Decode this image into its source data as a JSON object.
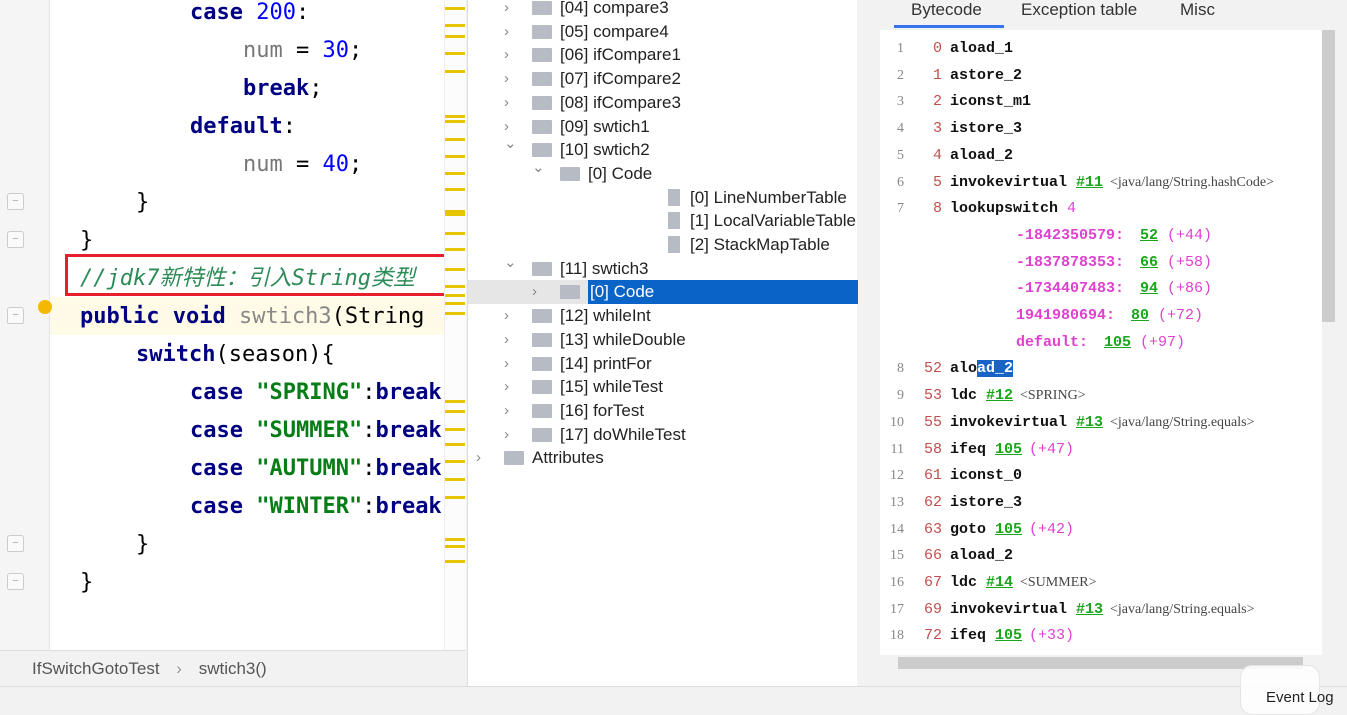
{
  "editor": {
    "lines": [
      {
        "indent": 3,
        "tokens": [
          [
            "case ",
            "kw"
          ],
          [
            "200",
            "num"
          ],
          [
            ":",
            "pl"
          ]
        ]
      },
      {
        "indent": 4,
        "tokens": [
          [
            "num",
            "var"
          ],
          [
            " = ",
            "pl"
          ],
          [
            "30",
            "num"
          ],
          [
            ";",
            "pl"
          ]
        ]
      },
      {
        "indent": 4,
        "tokens": [
          [
            "break",
            "kw"
          ],
          [
            ";",
            "pl"
          ]
        ]
      },
      {
        "indent": 3,
        "tokens": [
          [
            "default",
            "kw"
          ],
          [
            ":",
            "pl"
          ]
        ]
      },
      {
        "indent": 4,
        "tokens": [
          [
            "num",
            "var"
          ],
          [
            " = ",
            "pl"
          ],
          [
            "40",
            "num"
          ],
          [
            ";",
            "pl"
          ]
        ]
      },
      {
        "indent": 2,
        "tokens": [
          [
            "}",
            "pl"
          ]
        ]
      },
      {
        "indent": 1,
        "tokens": [
          [
            "}",
            "pl"
          ]
        ]
      },
      {
        "indent": 1,
        "tokens": [
          [
            "//jdk7新特性：引入String类型",
            "cm"
          ]
        ]
      },
      {
        "indent": 1,
        "tokens": [
          [
            "public void ",
            "kw"
          ],
          [
            "swtich3",
            "mt"
          ],
          [
            "(String ",
            "pl"
          ]
        ]
      },
      {
        "indent": 2,
        "tokens": [
          [
            "switch",
            "kw"
          ],
          [
            "(season){",
            "pl"
          ]
        ]
      },
      {
        "indent": 3,
        "tokens": [
          [
            "case ",
            "kw"
          ],
          [
            "\"SPRING\"",
            "str"
          ],
          [
            ":",
            "pl"
          ],
          [
            "break",
            "kw"
          ],
          [
            ";",
            "pl"
          ]
        ]
      },
      {
        "indent": 3,
        "tokens": [
          [
            "case ",
            "kw"
          ],
          [
            "\"SUMMER\"",
            "str"
          ],
          [
            ":",
            "pl"
          ],
          [
            "break",
            "kw"
          ],
          [
            ";",
            "pl"
          ]
        ]
      },
      {
        "indent": 3,
        "tokens": [
          [
            "case ",
            "kw"
          ],
          [
            "\"AUTUMN\"",
            "str"
          ],
          [
            ":",
            "pl"
          ],
          [
            "break",
            "kw"
          ],
          [
            ";",
            "pl"
          ]
        ]
      },
      {
        "indent": 3,
        "tokens": [
          [
            "case ",
            "kw"
          ],
          [
            "\"WINTER\"",
            "str"
          ],
          [
            ":",
            "pl"
          ],
          [
            "break",
            "kw"
          ],
          [
            ";",
            "pl"
          ]
        ]
      },
      {
        "indent": 2,
        "tokens": [
          [
            "}",
            "pl"
          ]
        ]
      },
      {
        "indent": 1,
        "tokens": [
          [
            "}",
            "pl"
          ]
        ]
      }
    ]
  },
  "breadcrumb": {
    "class": "IfSwitchGotoTest",
    "sep": "›",
    "method": "swtich3()"
  },
  "tree": {
    "items": [
      {
        "label": "[04] compare3",
        "level": 1,
        "chev": ">",
        "icon": "folder"
      },
      {
        "label": "[05] compare4",
        "level": 1,
        "chev": ">",
        "icon": "folder"
      },
      {
        "label": "[06] ifCompare1",
        "level": 1,
        "chev": ">",
        "icon": "folder"
      },
      {
        "label": "[07] ifCompare2",
        "level": 1,
        "chev": ">",
        "icon": "folder"
      },
      {
        "label": "[08] ifCompare3",
        "level": 1,
        "chev": ">",
        "icon": "folder"
      },
      {
        "label": "[09] swtich1",
        "level": 1,
        "chev": ">",
        "icon": "folder"
      },
      {
        "label": "[10] swtich2",
        "level": 1,
        "chev": "v",
        "icon": "folder"
      },
      {
        "label": "[0] Code",
        "level": 2,
        "chev": "v",
        "icon": "folder"
      },
      {
        "label": "[0] LineNumberTable",
        "level": 3,
        "chev": "",
        "icon": "file"
      },
      {
        "label": "[1] LocalVariableTable",
        "level": 3,
        "chev": "",
        "icon": "file"
      },
      {
        "label": "[2] StackMapTable",
        "level": 3,
        "chev": "",
        "icon": "file"
      },
      {
        "label": "[11] swtich3",
        "level": 1,
        "chev": "v",
        "icon": "folder"
      },
      {
        "label": "[0] Code",
        "level": 2,
        "chev": ">",
        "icon": "folder",
        "selected": true
      },
      {
        "label": "[12] whileInt",
        "level": 1,
        "chev": ">",
        "icon": "folder"
      },
      {
        "label": "[13] whileDouble",
        "level": 1,
        "chev": ">",
        "icon": "folder"
      },
      {
        "label": "[14] printFor",
        "level": 1,
        "chev": ">",
        "icon": "folder"
      },
      {
        "label": "[15] whileTest",
        "level": 1,
        "chev": ">",
        "icon": "folder"
      },
      {
        "label": "[16] forTest",
        "level": 1,
        "chev": ">",
        "icon": "folder"
      },
      {
        "label": "[17] doWhileTest",
        "level": 1,
        "chev": ">",
        "icon": "folder"
      },
      {
        "label": "Attributes",
        "level": 0,
        "chev": ">",
        "icon": "folder"
      }
    ]
  },
  "bytecode": {
    "tabs": [
      "Bytecode",
      "Exception table",
      "Misc"
    ],
    "active_tab": "Bytecode",
    "lines": [
      {
        "n": "1",
        "off": "0",
        "ins": "aload_1"
      },
      {
        "n": "2",
        "off": "1",
        "ins": "astore_2"
      },
      {
        "n": "3",
        "off": "2",
        "ins": "iconst_m1"
      },
      {
        "n": "4",
        "off": "3",
        "ins": "istore_3"
      },
      {
        "n": "5",
        "off": "4",
        "ins": "aload_2"
      },
      {
        "n": "6",
        "off": "5",
        "ins": "invokevirtual",
        "ref": "#11",
        "cmt": "<java/lang/String.hashCode>"
      },
      {
        "n": "7",
        "off": "8",
        "ins": "lookupswitch",
        "arg": "4"
      },
      {
        "case": "-1842350579:",
        "target": "52",
        "rel": "(+44)"
      },
      {
        "case": "-1837878353:",
        "target": "66",
        "rel": "(+58)"
      },
      {
        "case": "-1734407483:",
        "target": "94",
        "rel": "(+86)"
      },
      {
        "case": "1941980694:",
        "target": "80",
        "rel": "(+72)"
      },
      {
        "case": "default:",
        "target": "105",
        "rel": "(+97)"
      },
      {
        "n": "8",
        "off": "52",
        "ins": "aload_2",
        "sel_from": 3
      },
      {
        "n": "9",
        "off": "53",
        "ins": "ldc",
        "ref": "#12",
        "cmt": "<SPRING>"
      },
      {
        "n": "10",
        "off": "55",
        "ins": "invokevirtual",
        "ref": "#13",
        "cmt": "<java/lang/String.equals>"
      },
      {
        "n": "11",
        "off": "58",
        "ins": "ifeq",
        "ref": "105",
        "rel": "(+47)"
      },
      {
        "n": "12",
        "off": "61",
        "ins": "iconst_0"
      },
      {
        "n": "13",
        "off": "62",
        "ins": "istore_3"
      },
      {
        "n": "14",
        "off": "63",
        "ins": "goto",
        "ref": "105",
        "rel": "(+42)"
      },
      {
        "n": "15",
        "off": "66",
        "ins": "aload_2"
      },
      {
        "n": "16",
        "off": "67",
        "ins": "ldc",
        "ref": "#14",
        "cmt": "<SUMMER>"
      },
      {
        "n": "17",
        "off": "69",
        "ins": "invokevirtual",
        "ref": "#13",
        "cmt": "<java/lang/String.equals>"
      },
      {
        "n": "18",
        "off": "72",
        "ins": "ifeq",
        "ref": "105",
        "rel": "(+33)"
      }
    ]
  },
  "status": {
    "event_log": "Event Log"
  },
  "colors": {
    "selection": "#0a64c8",
    "highlight_box": "#e5202a",
    "link": "#1aa61a",
    "pink": "#e040d0"
  }
}
